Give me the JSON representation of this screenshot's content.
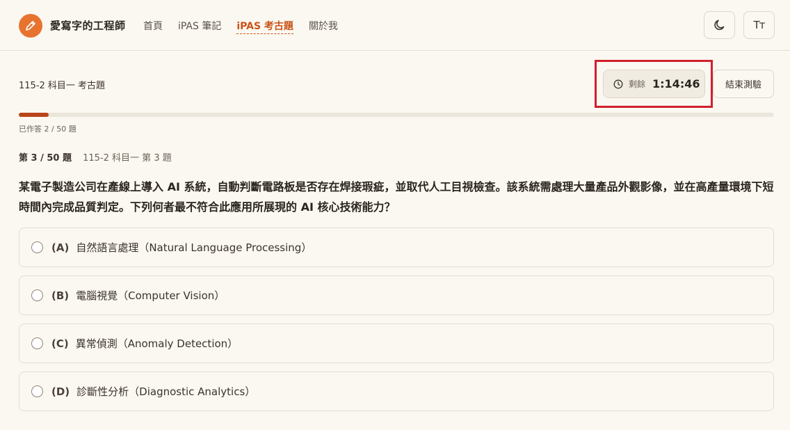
{
  "header": {
    "brand": "愛寫字的工程師",
    "nav": [
      {
        "label": "首頁",
        "active": false
      },
      {
        "label": "iPAS 筆記",
        "active": false
      },
      {
        "label": "iPAS 考古題",
        "active": true
      },
      {
        "label": "關於我",
        "active": false
      }
    ],
    "theme_icon": "moon-icon",
    "font_size_label": "Tт"
  },
  "exam": {
    "title": "115-2 科目一 考古題",
    "timer_label": "剩餘",
    "timer_value": "1:14:46",
    "end_button": "結束測驗",
    "progress_text": "已作答 2 / 50 題",
    "progress_fraction": 0.04
  },
  "question": {
    "number": "第 3 / 50 題",
    "source": "115-2 科目一 第 3 題",
    "text": "某電子製造公司在產線上導入 AI 系統，自動判斷電路板是否存在焊接瑕疵，並取代人工目視檢查。該系統需處理大量產品外觀影像，並在高產量環境下短時間內完成品質判定。下列何者最不符合此應用所展現的 AI 核心技術能力？",
    "options": [
      {
        "letter": "(A)",
        "text": "自然語言處理（Natural Language Processing）"
      },
      {
        "letter": "(B)",
        "text": "電腦視覺（Computer Vision）"
      },
      {
        "letter": "(C)",
        "text": "異常偵測（Anomaly Detection）"
      },
      {
        "letter": "(D)",
        "text": "診斷性分析（Diagnostic Analytics）"
      }
    ]
  },
  "colors": {
    "accent": "#c95418",
    "progress": "#b9461a",
    "highlight": "#d0202e",
    "background": "#fbf8f1"
  }
}
